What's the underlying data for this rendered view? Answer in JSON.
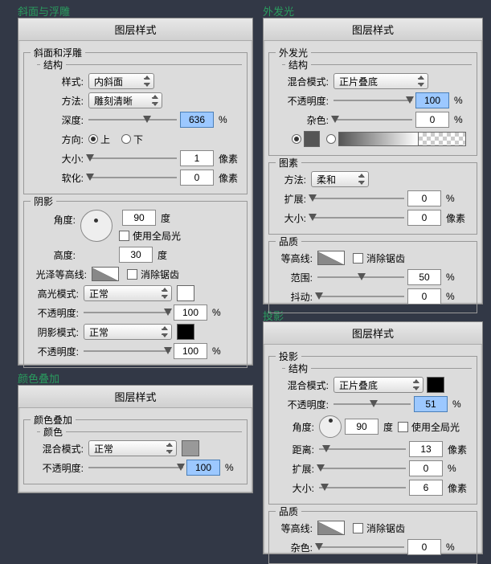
{
  "titles": {
    "bevel": "斜面与浮雕",
    "outerGlow": "外发光",
    "colorOverlay": "颜色叠加",
    "dropShadow": "投影"
  },
  "common": {
    "panelHeader": "图层样式",
    "structure": "结构",
    "shadow": "阴影",
    "elements": "图素",
    "quality": "品质",
    "color": "颜色"
  },
  "labels": {
    "style": "样式:",
    "method": "方法:",
    "depth": "深度:",
    "direction": "方向:",
    "size": "大小:",
    "soften": "软化:",
    "angle": "角度:",
    "altitude": "高度:",
    "gloss": "光泽等高线:",
    "highlight": "高光模式:",
    "opacity": "不透明度:",
    "shadowMode": "阴影模式:",
    "blend": "混合模式:",
    "noise": "杂色:",
    "spread": "扩展:",
    "contour": "等高线:",
    "range": "范围:",
    "jitter": "抖动:",
    "distance": "距离:",
    "up": "上",
    "down": "下",
    "useGlobal": "使用全局光",
    "antiAlias": "消除锯齿",
    "soft": "柔和"
  },
  "units": {
    "percent": "%",
    "px": "像素",
    "deg": "度"
  },
  "bevel": {
    "title": "斜面和浮雕",
    "style": "内斜面",
    "method": "雕刻清晰",
    "depth": "636",
    "size": "1",
    "soften": "0",
    "angle": "90",
    "altitude": "30",
    "highlightMode": "正常",
    "hiOpacity": "100",
    "shadowMode": "正常",
    "shOpacity": "100"
  },
  "colorOverlay": {
    "title": "颜色叠加",
    "blend": "正常",
    "opacity": "100"
  },
  "outerGlow": {
    "title": "外发光",
    "blend": "正片叠底",
    "opacity": "100",
    "noise": "0",
    "method": "柔和",
    "spread": "0",
    "size": "0",
    "range": "50",
    "jitter": "0"
  },
  "dropShadow": {
    "title": "投影",
    "blend": "正片叠底",
    "opacity": "51",
    "angle": "90",
    "distance": "13",
    "spread": "0",
    "size": "6",
    "noise": "0"
  }
}
